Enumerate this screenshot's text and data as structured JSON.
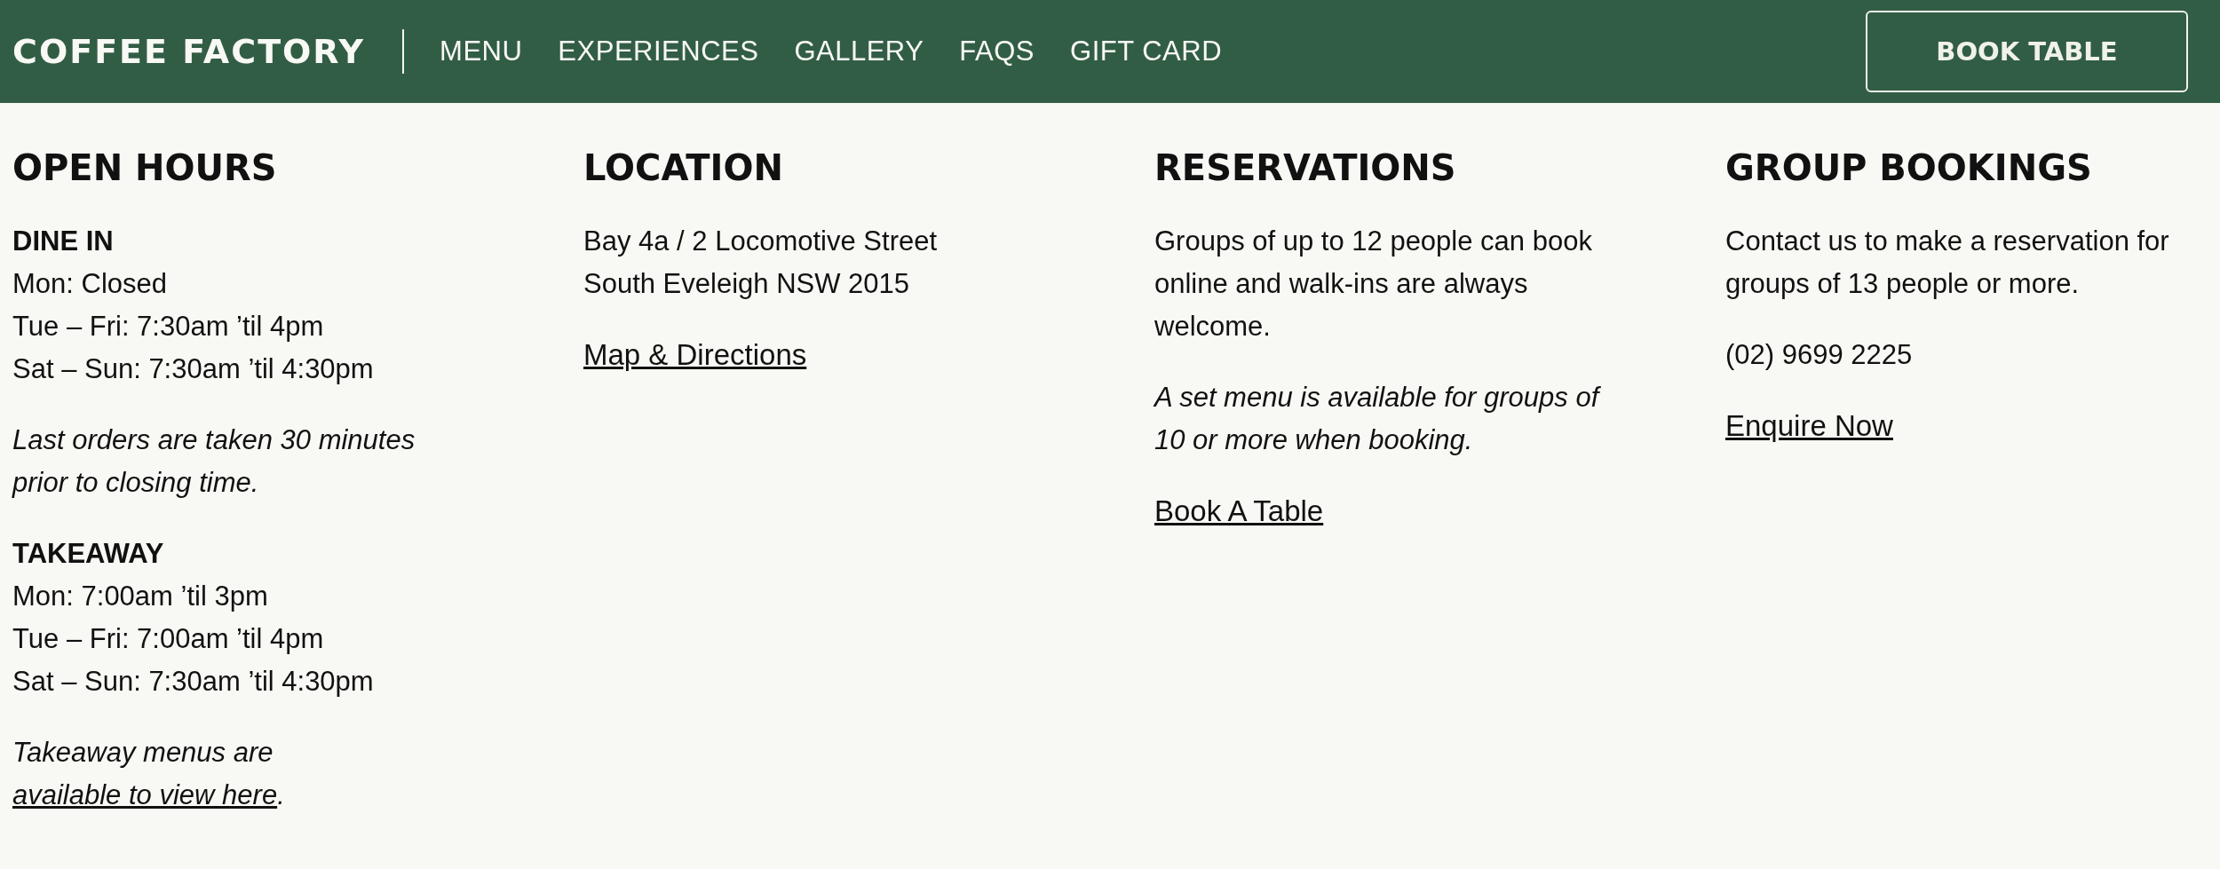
{
  "header": {
    "logo": "COFFEE FACTORY",
    "nav": [
      "MENU",
      "EXPERIENCES",
      "GALLERY",
      "FAQS",
      "GIFT CARD"
    ],
    "button": "BOOK TABLE"
  },
  "sections": [
    {
      "title": "OPEN HOURS",
      "blocks": [
        {
          "kind": "hours",
          "heading": "DINE IN",
          "lines": [
            "Mon: Closed",
            "Tue – Fri: 7:30am ’til 4pm",
            "Sat – Sun: 7:30am ’til 4:30pm"
          ]
        },
        {
          "kind": "note",
          "text": "Last orders are taken 30 minutes prior to closing time."
        },
        {
          "kind": "hours",
          "heading": "TAKEAWAY",
          "lines": [
            "Mon: 7:00am ’til 3pm",
            "Tue – Fri: 7:00am ’til 4pm",
            "Sat – Sun: 7:30am ’til 4:30pm"
          ]
        },
        {
          "kind": "note",
          "text": "Takeaway menus are ",
          "link": "available to view here",
          "after": "."
        }
      ]
    },
    {
      "title": "LOCATION",
      "blocks": [
        {
          "kind": "lines",
          "lines": [
            "Bay 4a / 2 Locomotive Street",
            "South Eveleigh NSW 2015"
          ]
        },
        {
          "kind": "link",
          "text": "Map & Directions"
        }
      ]
    },
    {
      "title": "RESERVATIONS",
      "blocks": [
        {
          "kind": "text",
          "text": "Groups of up to 12 people can book online and walk-ins are always welcome."
        },
        {
          "kind": "note",
          "text": "A set menu is available for groups of 10 or more when booking."
        },
        {
          "kind": "link",
          "text": "Book A Table"
        }
      ]
    },
    {
      "title": "GROUP BOOKINGS",
      "blocks": [
        {
          "kind": "text",
          "text": "Contact us to make a reservation for groups of 13 people or more."
        },
        {
          "kind": "text",
          "text": "(02) 9699 2225"
        },
        {
          "kind": "link",
          "text": "Enquire Now"
        }
      ]
    }
  ]
}
